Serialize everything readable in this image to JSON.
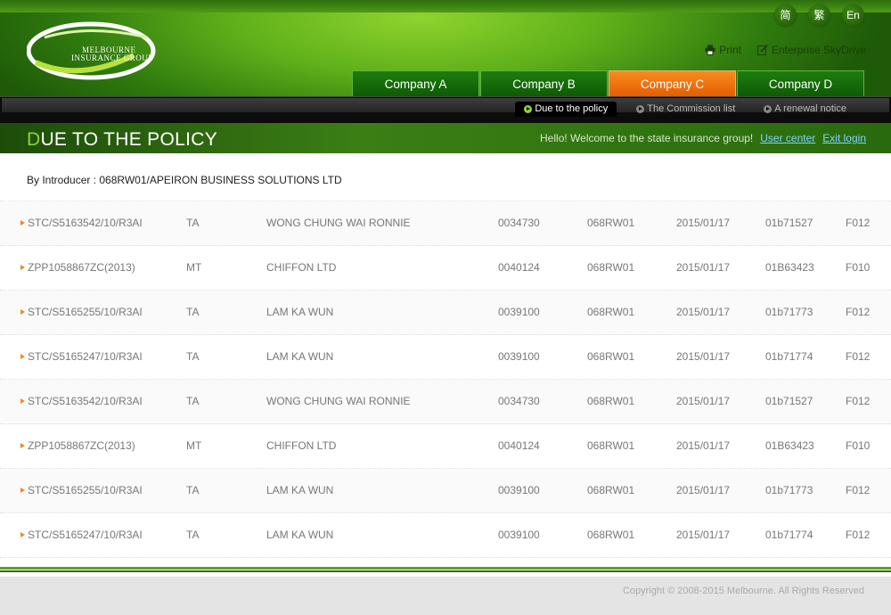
{
  "brand": {
    "logo_line1": "MELBOURNE",
    "logo_line2": "INSURANCE GROUP",
    "logo_mark": "MG"
  },
  "languages": [
    "简",
    "繁",
    "En"
  ],
  "tools": {
    "print": "Print",
    "skydrive": "Enterprise SkyDrive"
  },
  "tabs": [
    {
      "label": "Company A",
      "active": false
    },
    {
      "label": "Company B",
      "active": false
    },
    {
      "label": "Company C",
      "active": true
    },
    {
      "label": "Company D",
      "active": false
    }
  ],
  "subnav": [
    {
      "label": "Due to the policy",
      "active": true
    },
    {
      "label": "The Commission list",
      "active": false
    },
    {
      "label": "A renewal notice",
      "active": false
    }
  ],
  "page_title_first": "D",
  "page_title_rest": "UE TO THE POLICY",
  "welcome": {
    "text": "Hello! Welcome to the state insurance group!",
    "user_center": "User center",
    "exit": "Exit login"
  },
  "introducer": "By Introducer : 068RW01/APEIRON BUSINESS SOLUTIONS LTD",
  "rows": [
    [
      "STC/S5163542/10/R3AI",
      "TA",
      "WONG CHUNG WAI RONNIE",
      "0034730",
      "068RW01",
      "2015/01/17",
      "01b71527",
      "F012"
    ],
    [
      "ZPP1058867ZC(2013)",
      "MT",
      "CHIFFON LTD",
      "0040124",
      "068RW01",
      "2015/01/17",
      "01B63423",
      "F010"
    ],
    [
      "STC/S5165255/10/R3AI",
      "TA",
      "LAM KA WUN",
      "0039100",
      "068RW01",
      "2015/01/17",
      "01b71773",
      "F012"
    ],
    [
      "STC/S5165247/10/R3AI",
      "TA",
      "LAM KA WUN",
      "0039100",
      "068RW01",
      "2015/01/17",
      "01b71774",
      "F012"
    ],
    [
      "STC/S5163542/10/R3AI",
      "TA",
      "WONG CHUNG WAI RONNIE",
      "0034730",
      "068RW01",
      "2015/01/17",
      "01b71527",
      "F012"
    ],
    [
      "ZPP1058867ZC(2013)",
      "MT",
      "CHIFFON LTD",
      "0040124",
      "068RW01",
      "2015/01/17",
      "01B63423",
      "F010"
    ],
    [
      "STC/S5165255/10/R3AI",
      "TA",
      "LAM KA WUN",
      "0039100",
      "068RW01",
      "2015/01/17",
      "01b71773",
      "F012"
    ],
    [
      "STC/S5165247/10/R3AI",
      "TA",
      "LAM KA WUN",
      "0039100",
      "068RW01",
      "2015/01/17",
      "01b71774",
      "F012"
    ]
  ],
  "footer": "Copyright © 2008-2015 Melbourne. All Rights Reserved"
}
